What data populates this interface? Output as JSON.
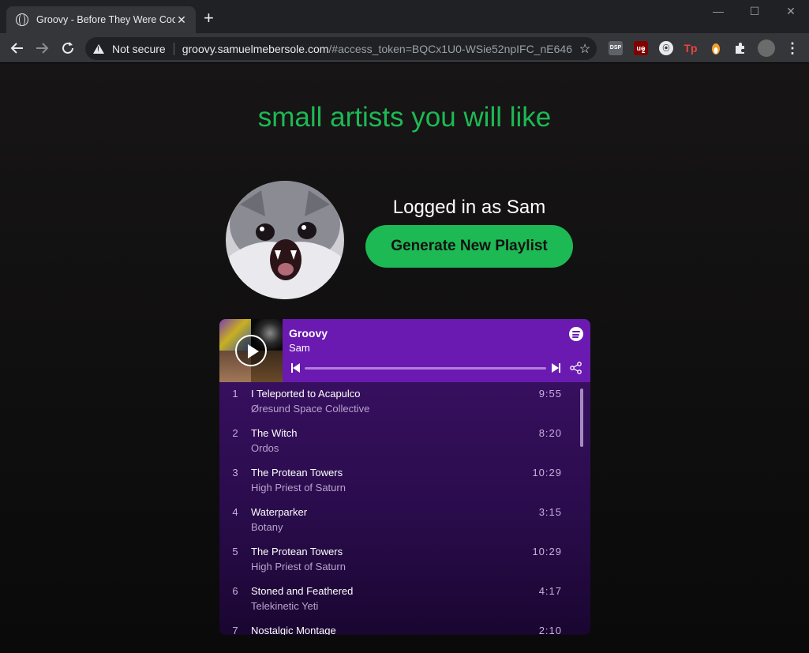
{
  "browser": {
    "tab_title": "Groovy - Before They Were Cool",
    "tab_close": "✕",
    "new_tab": "+",
    "security_label": "Not secure",
    "url_host": "groovy.samuelmebersole.com",
    "url_path": "/#access_token=BQCx1U0-WSie52npIFC_nE646...",
    "bookmark_icon": "☆",
    "menu_icon": "⋮",
    "window_controls": {
      "minimize": "—",
      "maximize": "☐",
      "close": "✕"
    },
    "extensions": {
      "dsp": "DSP",
      "ublock": "uo",
      "ublock_badge": "2",
      "tp": "Tp"
    }
  },
  "page": {
    "headline": "small artists you will like",
    "logged_in_text": "Logged in as Sam",
    "generate_button": "Generate New Playlist"
  },
  "playlist": {
    "title": "Groovy",
    "owner": "Sam",
    "colors": {
      "header": "#6a1ab0",
      "accent": "#1db954"
    },
    "tracks": [
      {
        "num": "1",
        "name": "I Teleported to Acapulco",
        "artist": "Øresund Space Collective",
        "duration": "9:55"
      },
      {
        "num": "2",
        "name": "The Witch",
        "artist": "Ordos",
        "duration": "8:20"
      },
      {
        "num": "3",
        "name": "The Protean Towers",
        "artist": "High Priest of Saturn",
        "duration": "10:29"
      },
      {
        "num": "4",
        "name": "Waterparker",
        "artist": "Botany",
        "duration": "3:15"
      },
      {
        "num": "5",
        "name": "The Protean Towers",
        "artist": "High Priest of Saturn",
        "duration": "10:29"
      },
      {
        "num": "6",
        "name": "Stoned and Feathered",
        "artist": "Telekinetic Yeti",
        "duration": "4:17"
      },
      {
        "num": "7",
        "name": "Nostalgic Montage",
        "artist": "",
        "duration": "2:10"
      }
    ]
  }
}
